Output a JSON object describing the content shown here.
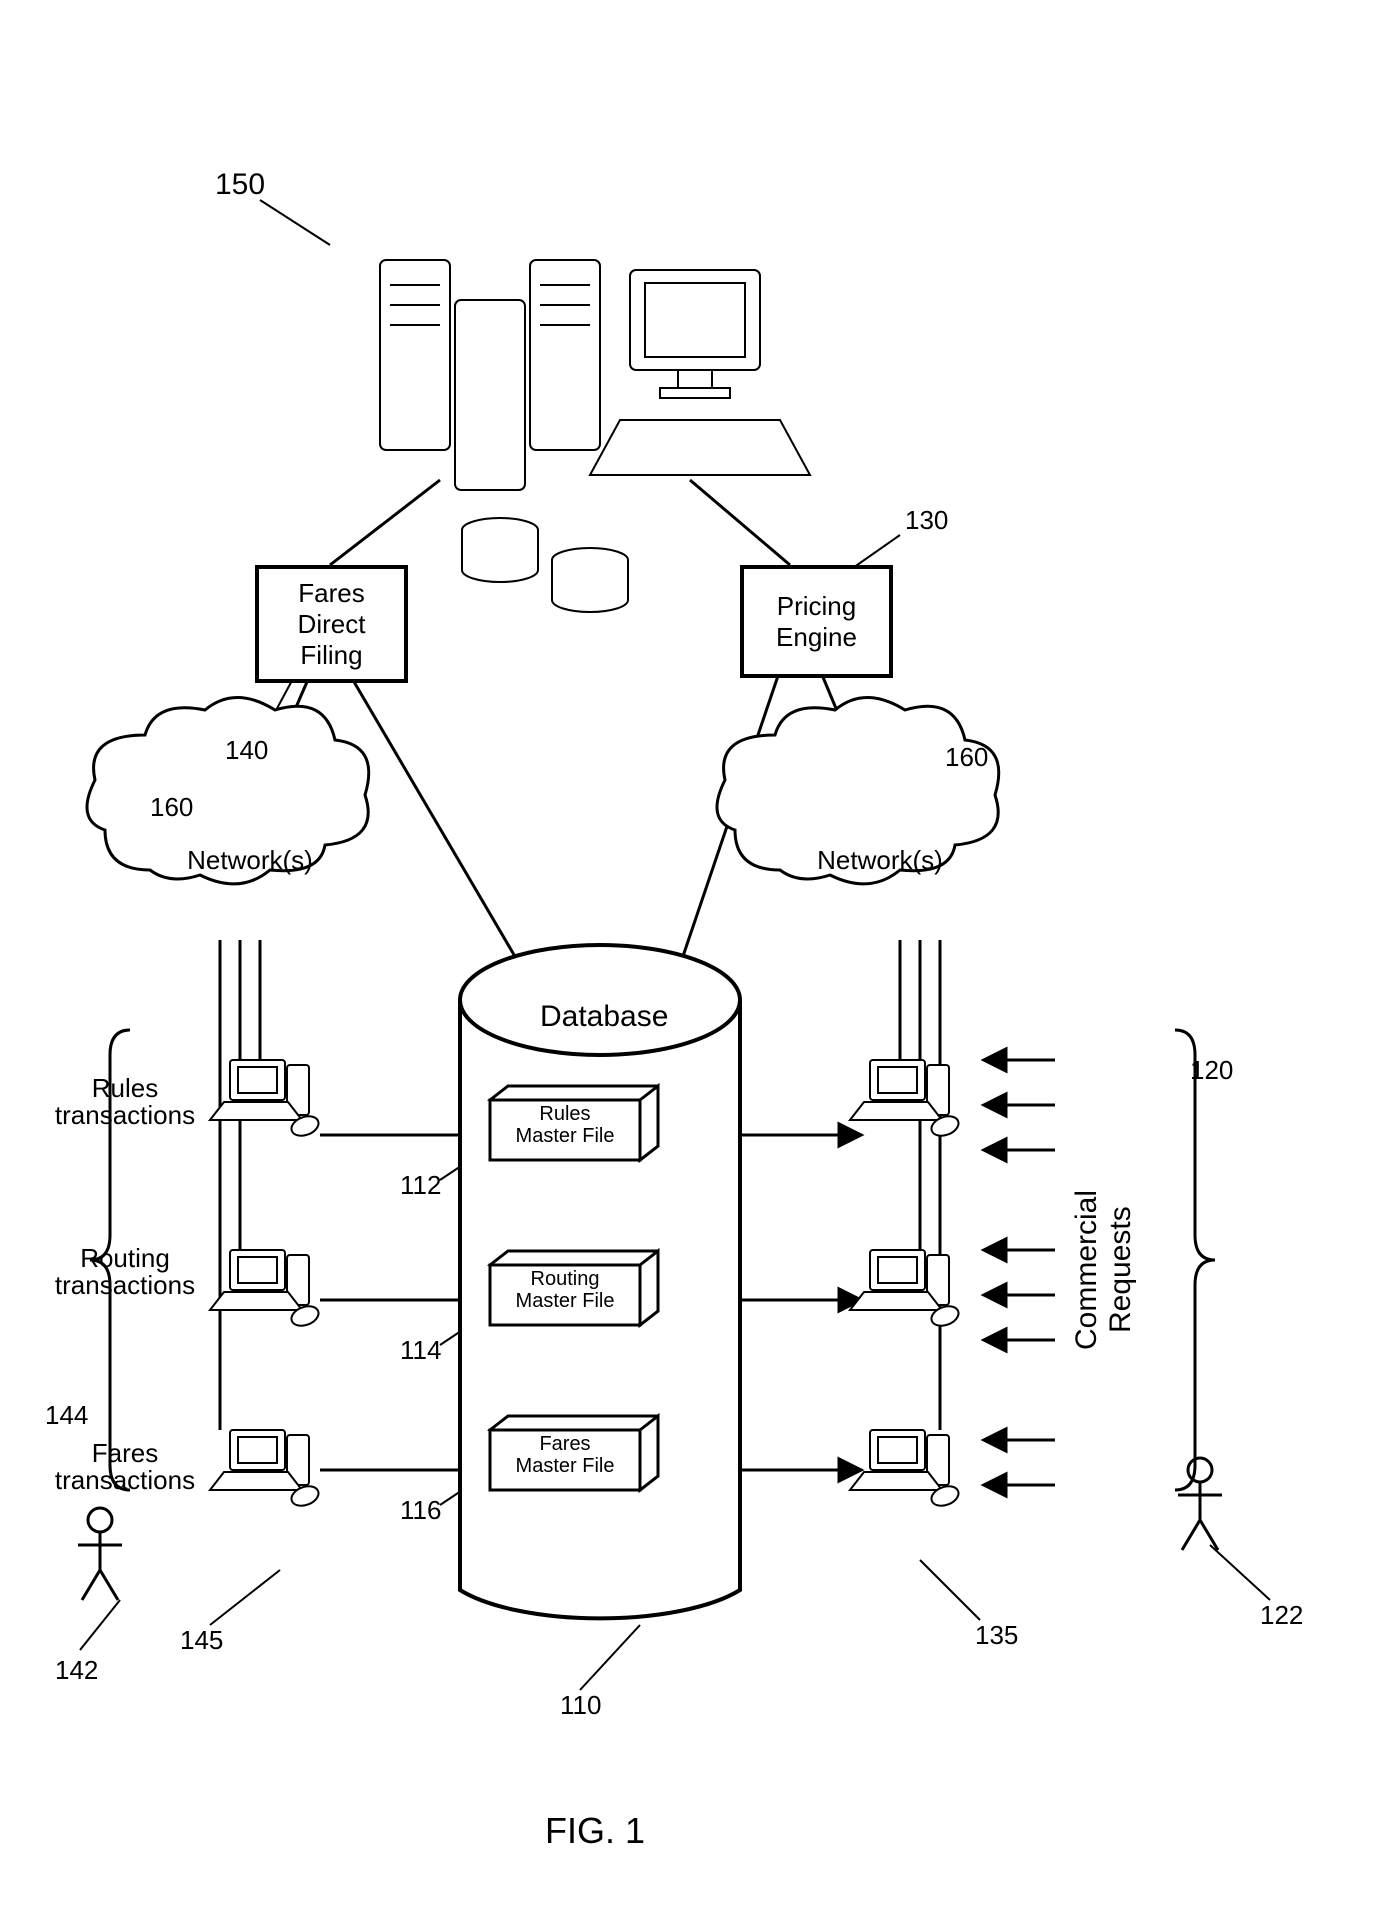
{
  "refs": {
    "system": "150",
    "faresFiling": "140",
    "pricing": "130",
    "netLeft": "160",
    "netRight": "160",
    "transactions": "144",
    "airlineUser": "142",
    "airlineTerm": "145",
    "db": "110",
    "rules": "112",
    "routing": "114",
    "fares": "116",
    "requests": "120",
    "custUser": "122",
    "custTerm": "135"
  },
  "labels": {
    "faresFiling": "Fares\nDirect\nFiling",
    "pricing": "Pricing\nEngine",
    "network": "Network(s)",
    "database": "Database",
    "rulesMF": "Rules\nMaster File",
    "routingMF": "Routing\nMaster File",
    "faresMF": "Fares\nMaster File",
    "rulesTx": "Rules\ntransactions",
    "routingTx": "Routing\ntransactions",
    "faresTx": "Fares\ntransactions",
    "commercial": "Commercial\nRequests",
    "figure": "FIG. 1"
  }
}
